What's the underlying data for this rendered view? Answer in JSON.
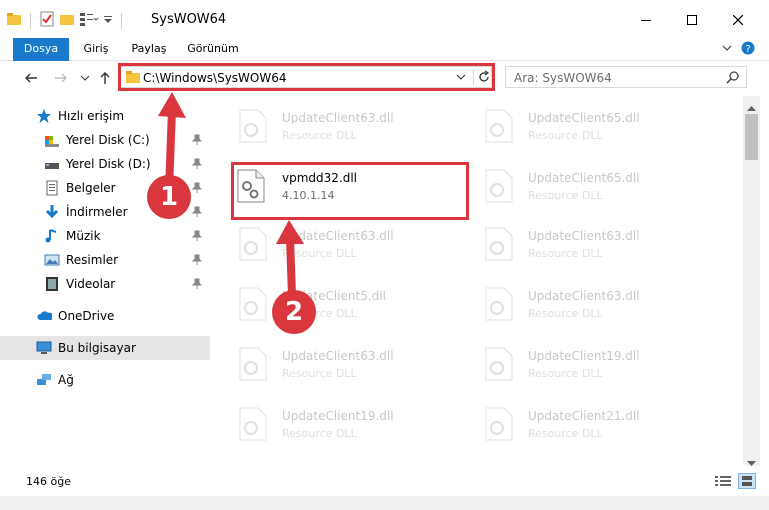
{
  "window": {
    "title": "SysWOW64"
  },
  "ribbon": {
    "tabs": [
      "Dosya",
      "Giriş",
      "Paylaş",
      "Görünüm"
    ]
  },
  "address": {
    "path": "C:\\Windows\\SysWOW64"
  },
  "search": {
    "placeholder": "Ara: SysWOW64"
  },
  "sidebar": {
    "items": [
      {
        "label": "Hızlı erişim",
        "icon": "star-icon"
      },
      {
        "label": "Yerel Disk (C:)",
        "icon": "drive-icon",
        "pinned": true
      },
      {
        "label": "Yerel Disk (D:)",
        "icon": "drive-icon",
        "pinned": true
      },
      {
        "label": "Belgeler",
        "icon": "documents-icon",
        "pinned": true
      },
      {
        "label": "İndirmeler",
        "icon": "download-icon",
        "pinned": true
      },
      {
        "label": "Müzik",
        "icon": "music-icon",
        "pinned": true
      },
      {
        "label": "Resimler",
        "icon": "pictures-icon",
        "pinned": true
      },
      {
        "label": "Videolar",
        "icon": "videos-icon",
        "pinned": true
      },
      {
        "label": "OneDrive",
        "icon": "cloud-icon"
      },
      {
        "label": "Bu bilgisayar",
        "icon": "computer-icon",
        "selected": true
      },
      {
        "label": "Ağ",
        "icon": "network-icon"
      }
    ]
  },
  "files": [
    {
      "name": "UpdateClient63.dll",
      "sub": "Resource DLL"
    },
    {
      "name": "UpdateClient65.dll",
      "sub": "Resource DLL"
    },
    {
      "name": "vpmdd32.dll",
      "sub": "4.10.1.14"
    },
    {
      "name": "UpdateClient65.dll",
      "sub": "Resource DLL"
    },
    {
      "name": "UpdateClient63.dll",
      "sub": "Resource DLL"
    },
    {
      "name": "UpdateClient63.dll",
      "sub": "Resource DLL"
    },
    {
      "name": "UpdateClient5.dll",
      "sub": "Resource DLL"
    },
    {
      "name": "UpdateClient63.dll",
      "sub": "Resource DLL"
    },
    {
      "name": "UpdateClient63.dll",
      "sub": "Resource DLL"
    },
    {
      "name": "UpdateClient19.dll",
      "sub": "Resource DLL"
    },
    {
      "name": "UpdateClient19.dll",
      "sub": "Resource DLL"
    },
    {
      "name": "UpdateClient21.dll",
      "sub": "Resource DLL"
    }
  ],
  "status": {
    "count": "146 öğe"
  },
  "annotations": {
    "step1": "1",
    "step2": "2"
  },
  "colors": {
    "accent": "#1979ca",
    "annotation": "#d9363e",
    "selection": "#e5e5e5"
  }
}
